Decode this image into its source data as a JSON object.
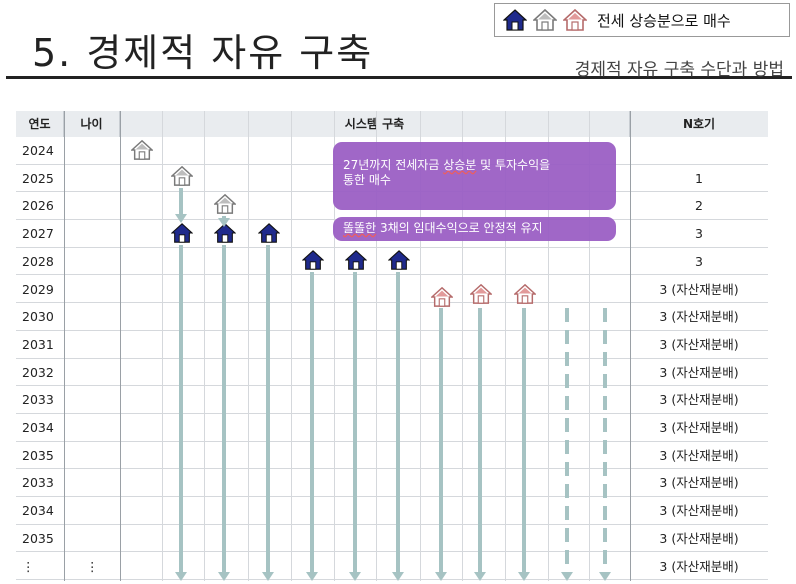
{
  "header": {
    "title": "5. 경제적 자유 구축",
    "subtitle": "경제적 자유 구축 수단과 방법"
  },
  "legend": {
    "text": "전세 상승분으로 매수",
    "icons": [
      "house-dark-icon",
      "house-gray-icon",
      "house-pink-icon"
    ]
  },
  "table": {
    "headers": [
      "연도",
      "나이",
      "시스템 구축",
      "N호기"
    ],
    "rows": [
      {
        "year": "2024",
        "age": "",
        "n": ""
      },
      {
        "year": "2025",
        "age": "",
        "n": "1"
      },
      {
        "year": "2026",
        "age": "",
        "n": "2"
      },
      {
        "year": "2027",
        "age": "",
        "n": "3"
      },
      {
        "year": "2028",
        "age": "",
        "n": "3"
      },
      {
        "year": "2029",
        "age": "",
        "n": "3 (자산재분배)"
      },
      {
        "year": "2030",
        "age": "",
        "n": "3 (자산재분배)"
      },
      {
        "year": "2031",
        "age": "",
        "n": "3 (자산재분배)"
      },
      {
        "year": "2032",
        "age": "",
        "n": "3 (자산재분배)"
      },
      {
        "year": "2033",
        "age": "",
        "n": "3 (자산재분배)"
      },
      {
        "year": "2034",
        "age": "",
        "n": "3 (자산재분배)"
      },
      {
        "year": "2035",
        "age": "",
        "n": "3 (자산재분배)"
      },
      {
        "year": "2033",
        "age": "",
        "n": "3 (자산재분배)"
      },
      {
        "year": "2034",
        "age": "",
        "n": "3 (자산재분배)"
      },
      {
        "year": "2035",
        "age": "",
        "n": "3 (자산재분배)"
      },
      {
        "year": "⋮",
        "age": "⋮",
        "n": "3 (자산재분배)"
      }
    ]
  },
  "notes": {
    "note1_line1_a": "27년까지 전세자금 ",
    "note1_underlined": "상승분",
    "note1_line1_b": " 및 투자수익을",
    "note1_line2": "통한 매수",
    "note2_underlined": "똘똘한",
    "note2_rest": " 3채의 임대수익으로 안정적 유지"
  },
  "colors": {
    "house_dark": "#1f2a8c",
    "house_gray": "#8a8a8a",
    "house_pink": "#e29a9a",
    "arrow": "#a6c3c3",
    "bubble": "#9b5fc5"
  }
}
